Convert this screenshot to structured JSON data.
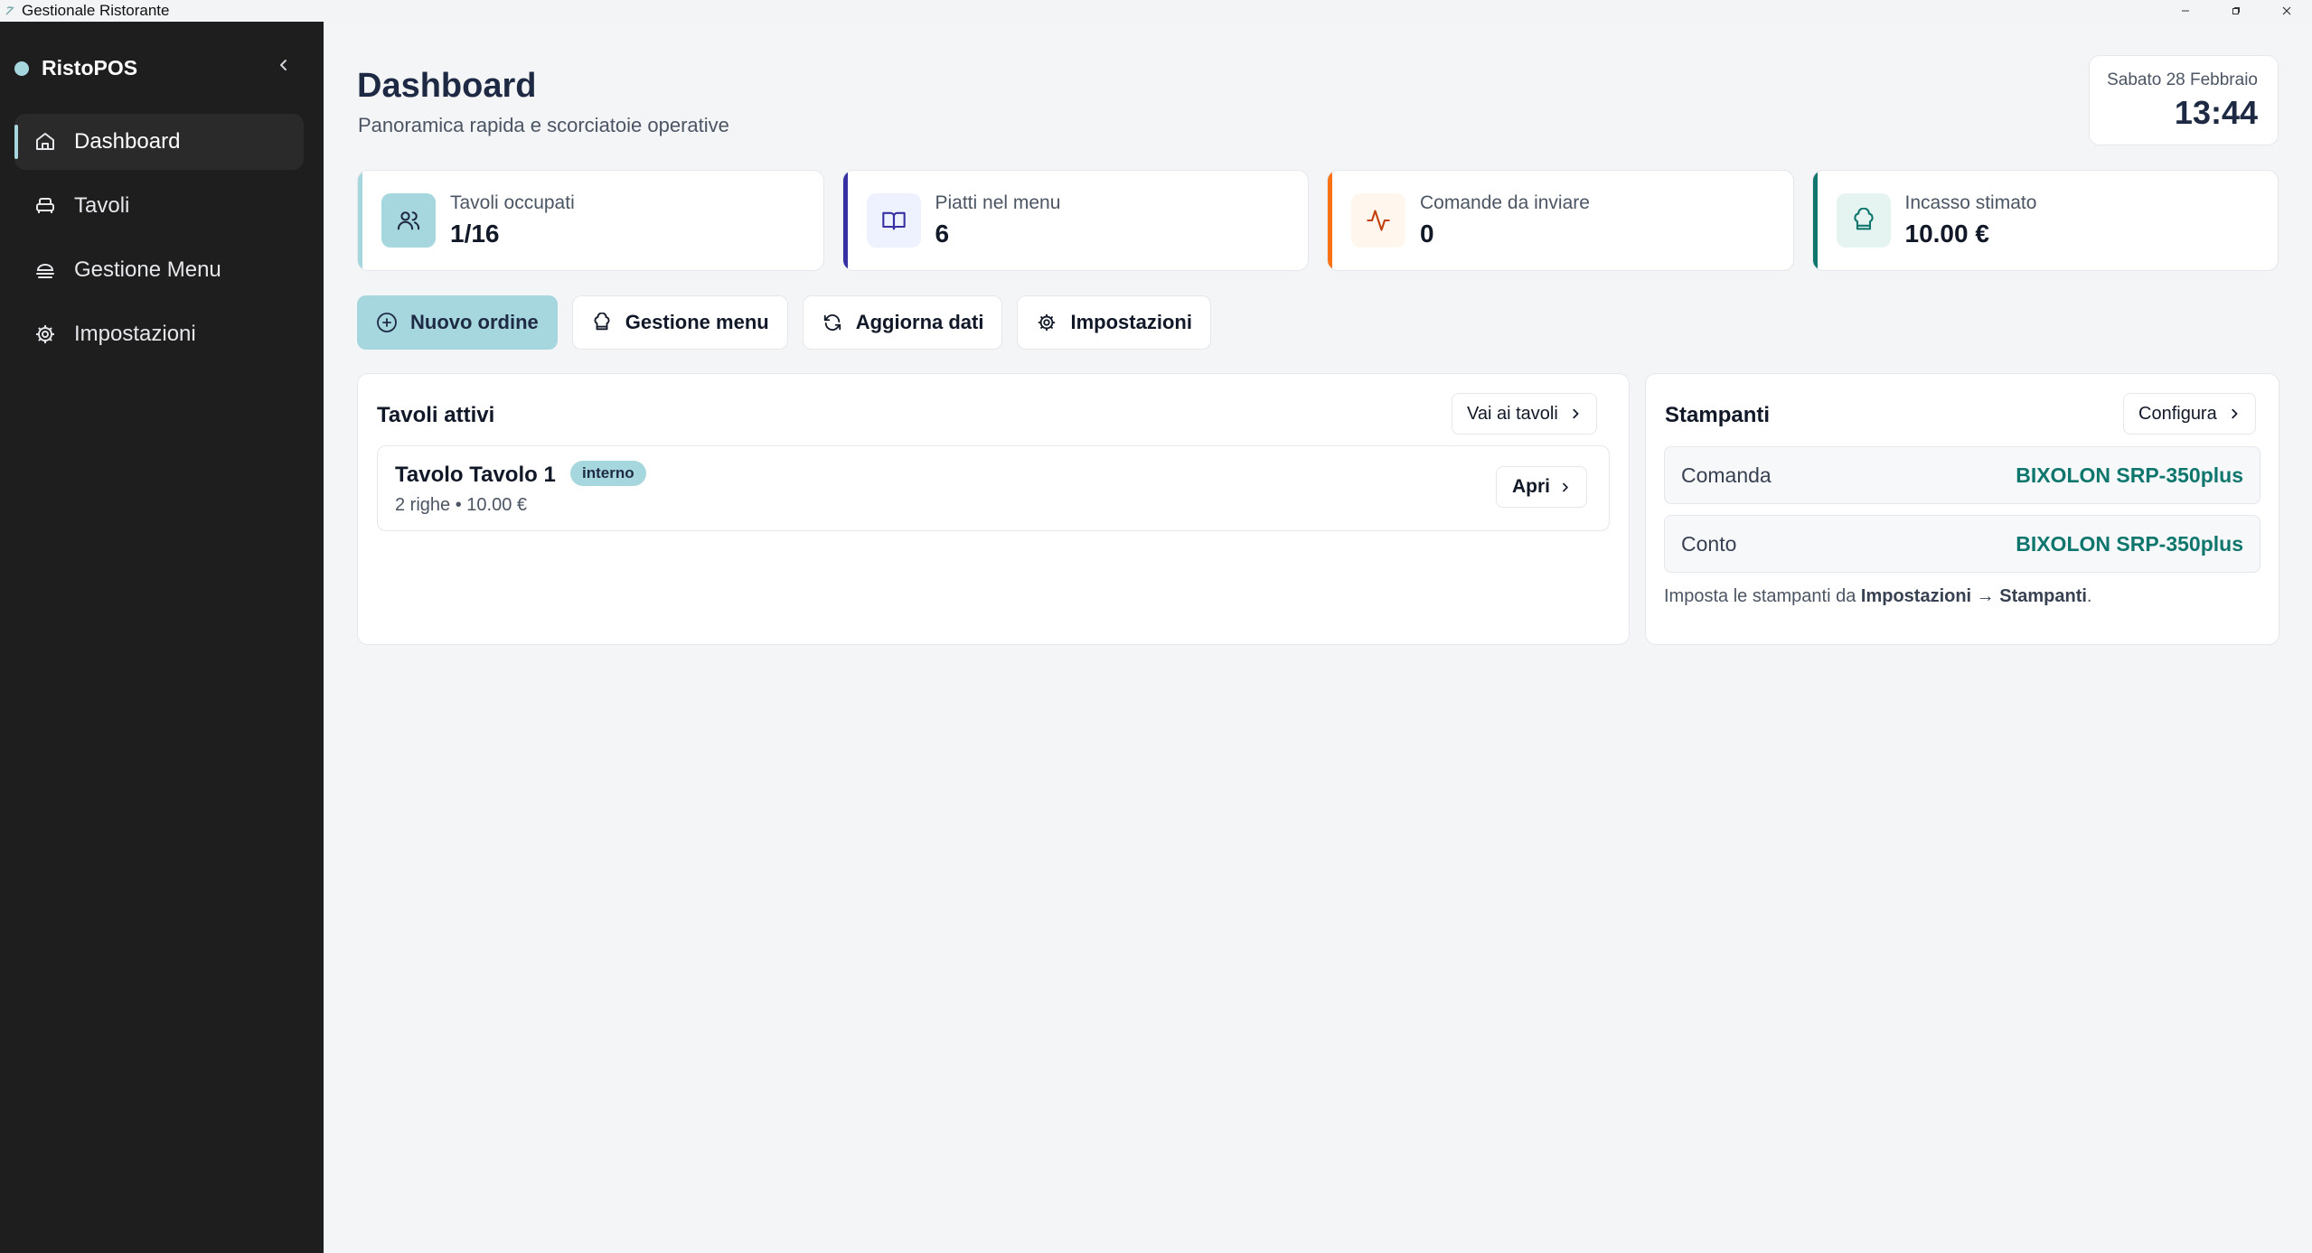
{
  "window": {
    "title": "Gestionale Ristorante",
    "controls": {
      "minimize": "–",
      "maximize": "❐",
      "close": "✕"
    }
  },
  "sidebar": {
    "brand": "RistoPOS",
    "items": [
      {
        "label": "Dashboard",
        "icon": "home-icon",
        "active": true
      },
      {
        "label": "Tavoli",
        "icon": "armchair-icon"
      },
      {
        "label": "Gestione Menu",
        "icon": "utensils-icon"
      },
      {
        "label": "Impostazioni",
        "icon": "gear-icon"
      }
    ]
  },
  "header": {
    "title": "Dashboard",
    "subtitle": "Panoramica rapida e scorciatoie operative",
    "date": "Sabato 28 Febbraio",
    "time": "13:44"
  },
  "stats": [
    {
      "label": "Tavoli occupati",
      "value": "1/16",
      "icon": "users-icon",
      "accent": "#a7d7de"
    },
    {
      "label": "Piatti nel menu",
      "value": "6",
      "icon": "book-open-icon",
      "accent": "#3730a3"
    },
    {
      "label": "Comande da inviare",
      "value": "0",
      "icon": "activity-icon",
      "accent": "#f97316"
    },
    {
      "label": "Incasso stimato",
      "value": "10.00 €",
      "icon": "chef-hat-icon",
      "accent": "#0f766e"
    }
  ],
  "actions": {
    "new_order": "Nuovo ordine",
    "menu": "Gestione menu",
    "refresh": "Aggiorna dati",
    "settings": "Impostazioni"
  },
  "active_tables": {
    "title": "Tavoli attivi",
    "link": "Vai ai tavoli",
    "rows": [
      {
        "name": "Tavolo Tavolo 1",
        "badge": "interno",
        "meta": "2 righe • 10.00 €",
        "open": "Apri"
      }
    ]
  },
  "printers": {
    "title": "Stampanti",
    "link": "Configura",
    "rows": [
      {
        "label": "Comanda",
        "value": "BIXOLON SRP-350plus"
      },
      {
        "label": "Conto",
        "value": "BIXOLON SRP-350plus"
      }
    ],
    "note_prefix": "Imposta le stampanti da ",
    "note_path": "Impostazioni → Stampanti",
    "note_suffix": "."
  },
  "colors": {
    "sidebar_bg": "#1e1e1e",
    "accent": "#a7d7de",
    "printer_value": "#0f766e"
  }
}
